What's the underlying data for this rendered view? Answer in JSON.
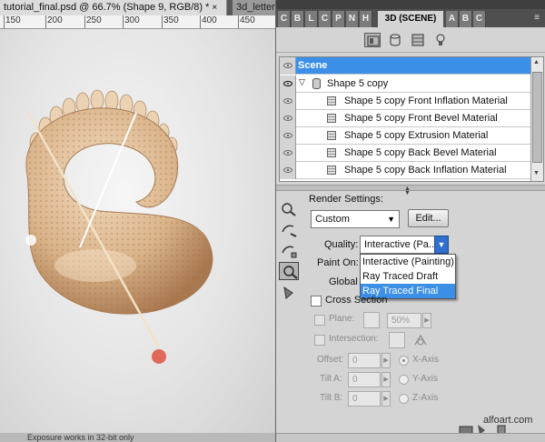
{
  "document": {
    "tab_active": "tutorial_final.psd @ 66.7% (Shape 9, RGB/8) *",
    "tab_active_close": "×",
    "tab_inactive": "3d_letter",
    "ruler_ticks": [
      "150",
      "200",
      "250",
      "300",
      "350",
      "400",
      "450"
    ],
    "status_text": "Exposure works in 32-bit only"
  },
  "panel": {
    "collapsed_tabs": [
      "C",
      "B",
      "L",
      "C",
      "P",
      "N",
      "H"
    ],
    "right_tabs": [
      "A",
      "B",
      "C"
    ],
    "active_tab": "3D (SCENE)",
    "menu_icon": "panel-menu-icon",
    "scene_list": {
      "header": "Scene",
      "items": [
        {
          "label": "Shape 5 copy",
          "type": "shape"
        },
        {
          "label": "Shape 5 copy Front Inflation Material",
          "type": "material"
        },
        {
          "label": "Shape 5 copy Front Bevel Material",
          "type": "material"
        },
        {
          "label": "Shape 5 copy Extrusion Material",
          "type": "material"
        },
        {
          "label": "Shape 5 copy Back Bevel Material",
          "type": "material"
        },
        {
          "label": "Shape 5 copy Back Inflation Material",
          "type": "material"
        }
      ]
    },
    "render": {
      "settings_label": "Render Settings:",
      "preset_value": "Custom",
      "edit_button": "Edit...",
      "quality_label": "Quality:",
      "quality_value": "Interactive (Pa...",
      "quality_options": [
        "Interactive (Painting)",
        "Ray Traced Draft",
        "Ray Traced Final"
      ],
      "quality_highlighted": "Ray Traced Final",
      "paint_on_label": "Paint On:",
      "global_label": "Global A"
    },
    "cross_section": {
      "label": "Cross Section",
      "plane_label": "Plane:",
      "plane_percent": "50%",
      "intersection_label": "Intersection:",
      "offset_label": "Offset:",
      "offset_value": "0",
      "tilt_a_label": "Tilt A:",
      "tilt_a_value": "0",
      "tilt_b_label": "Tilt B:",
      "tilt_b_value": "0",
      "axis_x": "X-Axis",
      "axis_y": "Y-Axis",
      "axis_z": "Z-Axis",
      "selected_axis": "X-Axis"
    },
    "watermark": "alfoart.com"
  },
  "colors": {
    "selection_blue": "#3b8fe6",
    "object_tan": "#d8b48e",
    "light_marker_red": "#e06a5a"
  }
}
